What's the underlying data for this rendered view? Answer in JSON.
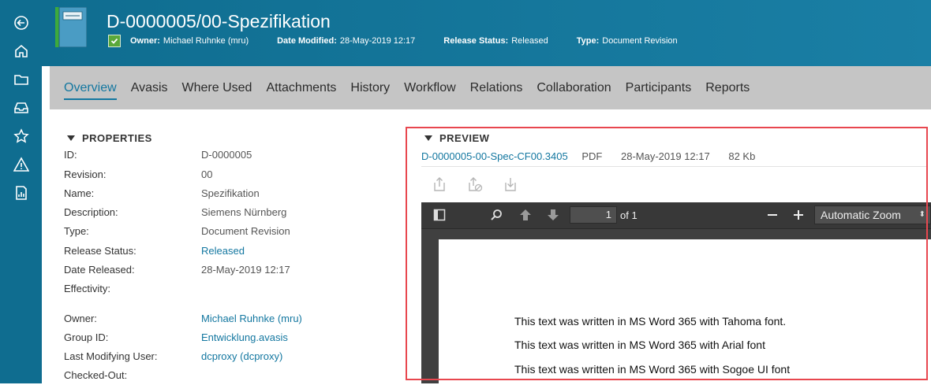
{
  "header": {
    "title": "D-0000005/00-Spezifikation",
    "owner_label": "Owner:",
    "owner_value": "Michael Ruhnke (mru)",
    "date_modified_label": "Date Modified:",
    "date_modified_value": "28-May-2019 12:17",
    "release_status_label": "Release Status:",
    "release_status_value": "Released",
    "type_label": "Type:",
    "type_value": "Document Revision"
  },
  "tabs": [
    {
      "label": "Overview"
    },
    {
      "label": "Avasis"
    },
    {
      "label": "Where Used"
    },
    {
      "label": "Attachments"
    },
    {
      "label": "History"
    },
    {
      "label": "Workflow"
    },
    {
      "label": "Relations"
    },
    {
      "label": "Collaboration"
    },
    {
      "label": "Participants"
    },
    {
      "label": "Reports"
    }
  ],
  "properties": {
    "title": "PROPERTIES",
    "rows": [
      {
        "label": "ID:",
        "value": "D-0000005"
      },
      {
        "label": "Revision:",
        "value": "00"
      },
      {
        "label": "Name:",
        "value": "Spezifikation"
      },
      {
        "label": "Description:",
        "value": "Siemens Nürnberg"
      },
      {
        "label": "Type:",
        "value": "Document Revision"
      },
      {
        "label": "Release Status:",
        "value": "Released"
      },
      {
        "label": "Date Released:",
        "value": "28-May-2019 12:17"
      },
      {
        "label": "Effectivity:",
        "value": ""
      },
      {
        "label": "Owner:",
        "value": "Michael Ruhnke (mru)"
      },
      {
        "label": "Group ID:",
        "value": "Entwicklung.avasis"
      },
      {
        "label": "Last Modifying User:",
        "value": "dcproxy (dcproxy)"
      },
      {
        "label": "Checked-Out:",
        "value": ""
      }
    ]
  },
  "preview": {
    "title": "PREVIEW",
    "file_name": "D-0000005-00-Spec-CF00.3405",
    "file_type": "PDF",
    "file_date": "28-May-2019 12:17",
    "file_size": "82 Kb",
    "viewer": {
      "page_number": "1",
      "page_of": "of 1",
      "zoom": "Automatic Zoom"
    },
    "page_lines": [
      "This text was written in MS Word 365 with Tahoma font.",
      "This text was written in MS Word 365 with Arial font",
      "This text was written in MS Word 365 with Sogoe UI font"
    ]
  },
  "colors": {
    "accent": "#1377a0",
    "header_bg": "#0f6d90",
    "highlight": "#e8474f"
  }
}
